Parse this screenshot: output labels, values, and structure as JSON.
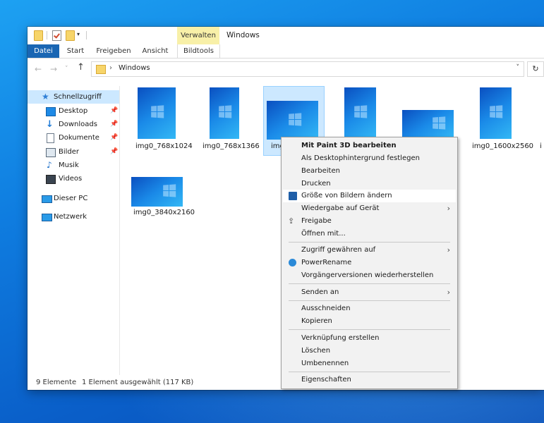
{
  "window": {
    "title": "Windows",
    "context_tab": "Verwalten"
  },
  "ribbon": {
    "tabs": [
      "Datei",
      "Start",
      "Freigeben",
      "Ansicht",
      "Bildtools"
    ]
  },
  "address": {
    "path": "Windows",
    "separator": "›"
  },
  "nav": {
    "back": "←",
    "forward": "→",
    "recent": "˅",
    "up": "↑",
    "dropdown": "˅",
    "refresh": "↻"
  },
  "sidebar": {
    "quick_access": "Schnellzugriff",
    "items": [
      {
        "label": "Desktop",
        "pinned": true
      },
      {
        "label": "Downloads",
        "pinned": true
      },
      {
        "label": "Dokumente",
        "pinned": true
      },
      {
        "label": "Bilder",
        "pinned": true
      },
      {
        "label": "Musik",
        "pinned": false
      },
      {
        "label": "Videos",
        "pinned": false
      }
    ],
    "this_pc": "Dieser PC",
    "network": "Netzwerk"
  },
  "files": [
    {
      "name": "img0_768x1024"
    },
    {
      "name": "img0_768x1366"
    },
    {
      "name": "img0_..."
    },
    {
      "name": ""
    },
    {
      "name": ""
    },
    {
      "name": "img0_1600x2560"
    },
    {
      "name": "i"
    },
    {
      "name": "img0_3840x2160"
    }
  ],
  "status": {
    "count": "9 Elemente",
    "selection": "1 Element ausgewählt (117 KB)"
  },
  "context_menu": {
    "items": [
      {
        "label": "Mit Paint 3D bearbeiten",
        "bold": true
      },
      {
        "label": "Als Desktophintergrund festlegen"
      },
      {
        "label": "Bearbeiten"
      },
      {
        "label": "Drucken"
      },
      {
        "label": "Größe von Bildern ändern",
        "icon": "resize-image-icon",
        "highlighted": true
      },
      {
        "label": "Wiedergabe auf Gerät",
        "submenu": true
      },
      {
        "label": "Freigabe",
        "icon": "share-icon"
      },
      {
        "label": "Öffnen mit..."
      },
      {
        "label": "Zugriff gewähren auf",
        "submenu": true
      },
      {
        "label": "PowerRename",
        "icon": "powerrename-icon"
      },
      {
        "label": "Vorgängerversionen wiederherstellen"
      },
      {
        "label": "Senden an",
        "submenu": true
      },
      {
        "label": "Ausschneiden"
      },
      {
        "label": "Kopieren"
      },
      {
        "label": "Verknüpfung erstellen"
      },
      {
        "label": "Löschen"
      },
      {
        "label": "Umbenennen"
      },
      {
        "label": "Eigenschaften"
      }
    ],
    "submenu_arrow": "›"
  },
  "colors": {
    "accent": "#1a66b3",
    "selection": "#cce8ff",
    "contextual_tab": "#f8f0a8",
    "desktop": "#0f7de0"
  }
}
